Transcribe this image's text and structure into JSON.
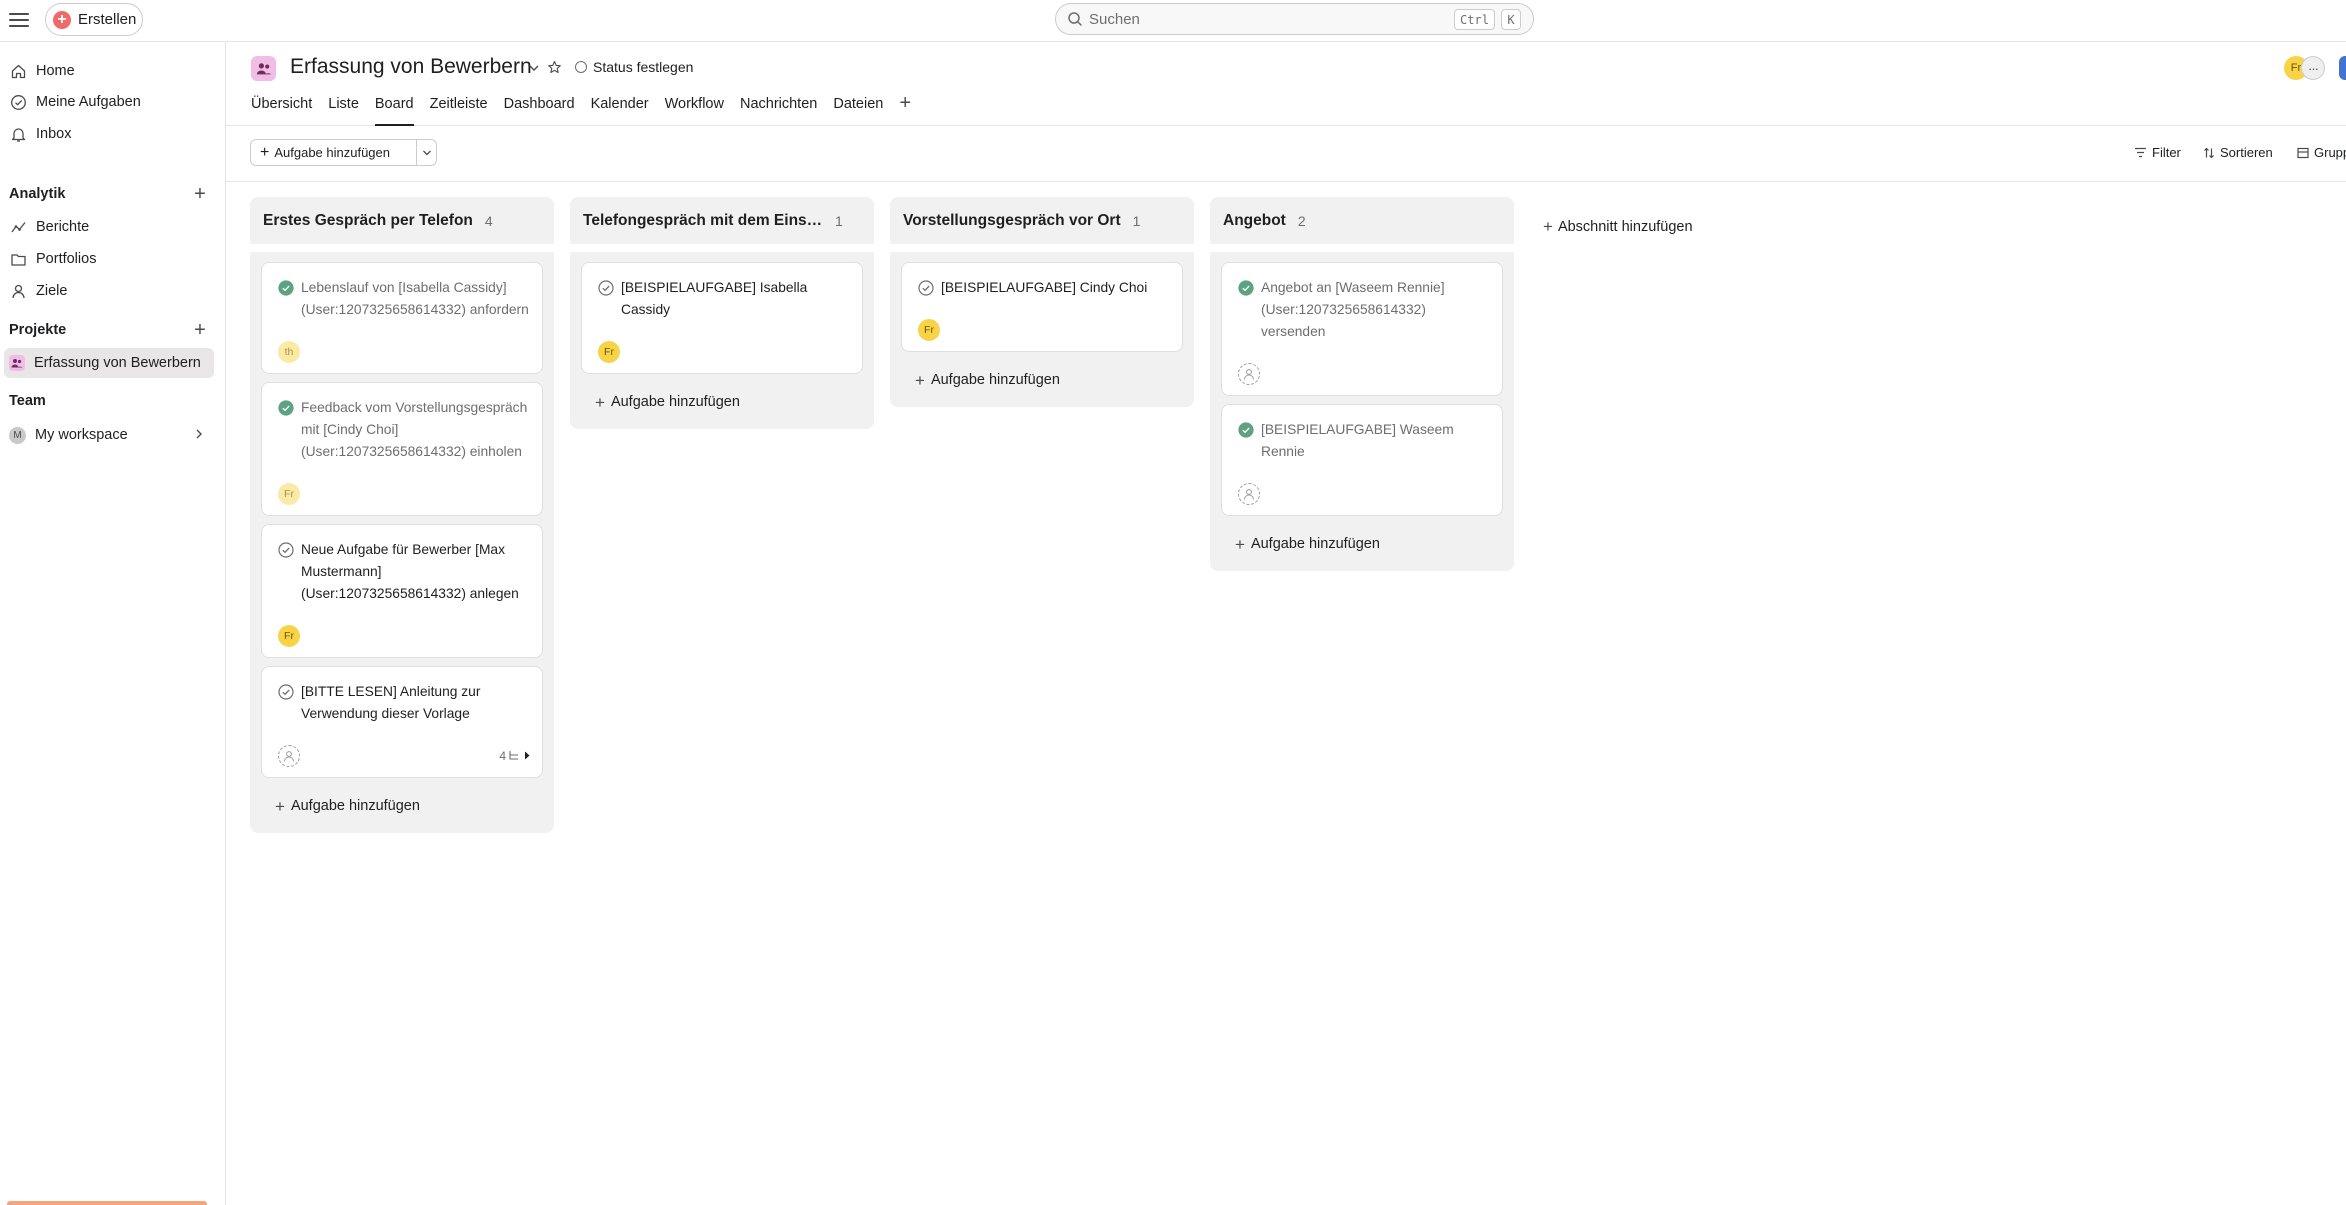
{
  "topbar": {
    "create_label": "Erstellen",
    "search": {
      "placeholder": "Suchen",
      "shortcut_ctrl": "Ctrl",
      "shortcut_key": "K"
    }
  },
  "sidebar": {
    "nav": [
      {
        "label": "Home",
        "icon": "home-icon"
      },
      {
        "label": "Meine Aufgaben",
        "icon": "check-circle-icon"
      },
      {
        "label": "Inbox",
        "icon": "bell-icon"
      }
    ],
    "analytics": {
      "title": "Analytik",
      "items": [
        {
          "label": "Berichte",
          "icon": "chart-line-icon"
        },
        {
          "label": "Portfolios",
          "icon": "folder-icon"
        },
        {
          "label": "Ziele",
          "icon": "person-icon"
        }
      ]
    },
    "projects": {
      "title": "Projekte",
      "items": [
        {
          "label": "Erfassung von Bewerbern"
        }
      ]
    },
    "team": {
      "title": "Team",
      "workspace_label": "My workspace",
      "workspace_avatar": "M"
    }
  },
  "project": {
    "title": "Erfassung von Bewerbern",
    "status_label": "Status festlegen",
    "tabs": [
      "Übersicht",
      "Liste",
      "Board",
      "Zeitleiste",
      "Dashboard",
      "Kalender",
      "Workflow",
      "Nachrichten",
      "Dateien"
    ],
    "active_tab": "Board",
    "member_avatar": "Fr",
    "more_label": "···"
  },
  "toolbar": {
    "add_task_label": "Aufgabe hinzufügen",
    "filter_label": "Filter",
    "sort_label": "Sortieren",
    "group_label": "Grupp"
  },
  "board": {
    "add_task_label": "Aufgabe hinzufügen",
    "add_section_label": "Abschnitt hinzufügen",
    "columns": [
      {
        "title": "Erstes Gespräch per Telefon",
        "count": "4",
        "cards": [
          {
            "title": "Lebenslauf von [Isabella Cassidy](User:1207325658614332) anfordern",
            "done": true,
            "avatar": "th",
            "avatar_faded": true
          },
          {
            "title": "Feedback vom Vorstellungsgespräch mit [Cindy Choi](User:1207325658614332) einholen",
            "done": true,
            "avatar": "Fr",
            "avatar_faded": true
          },
          {
            "title": "Neue Aufgabe für Bewerber [Max Mustermann](User:1207325658614332) anlegen",
            "done": false,
            "avatar": "Fr",
            "avatar_faded": false
          },
          {
            "title": "[BITTE LESEN] Anleitung zur Verwendung dieser Vorlage",
            "done": false,
            "avatar": "",
            "subtasks": "4"
          }
        ]
      },
      {
        "title": "Telefongespräch mit dem Einstel...",
        "count": "1",
        "cards": [
          {
            "title": "[BEISPIELAUFGABE] Isabella Cassidy",
            "done": false,
            "avatar": "Fr",
            "avatar_faded": false
          }
        ]
      },
      {
        "title": "Vorstellungsgespräch vor Ort",
        "count": "1",
        "cards": [
          {
            "title": "[BEISPIELAUFGABE] Cindy Choi",
            "done": false,
            "avatar": "Fr",
            "avatar_faded": false
          }
        ]
      },
      {
        "title": "Angebot",
        "count": "2",
        "cards": [
          {
            "title": "Angebot an [Waseem Rennie](User:1207325658614332) versenden",
            "done": true,
            "avatar": ""
          },
          {
            "title": "[BEISPIELAUFGABE] Waseem Rennie",
            "done": true,
            "avatar": ""
          }
        ]
      }
    ]
  },
  "colors": {
    "accent_red": "#f06a6a",
    "project_pink": "#f1bde6",
    "avatar_yellow": "#f8d347",
    "done_green": "#5da283",
    "column_bg": "#f2f1f1",
    "share_blue": "#4573d2"
  }
}
